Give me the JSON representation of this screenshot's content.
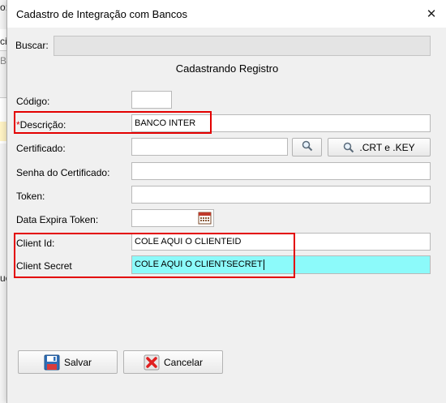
{
  "background": {
    "fragments": [
      "o:",
      "cia",
      "Ba",
      "ue"
    ]
  },
  "dialog": {
    "title": "Cadastro de Integração com Bancos",
    "close_symbol": "✕",
    "search": {
      "label": "Buscar:",
      "value": ""
    },
    "section_title": "Cadastrando Registro",
    "fields": {
      "codigo": {
        "label": "Código:",
        "value": ""
      },
      "descricao": {
        "required_mark": "*",
        "label": "Descrição:",
        "value": "BANCO INTER"
      },
      "certificado": {
        "label": "Certificado:",
        "value": ""
      },
      "senha_certificado": {
        "label": "Senha do Certificado:",
        "value": ""
      },
      "token": {
        "label": "Token:",
        "value": ""
      },
      "data_expira_token": {
        "label": "Data Expira Token:",
        "value": ""
      },
      "client_id": {
        "label": "Client Id:",
        "value": "COLE AQUI O CLIENTEID"
      },
      "client_secret": {
        "label": "Client Secret",
        "value": "COLE AQUI O CLIENTSECRET"
      }
    },
    "buttons": {
      "crt_key": ".CRT e .KEY",
      "salvar": "Salvar",
      "cancelar": "Cancelar"
    },
    "icons": {
      "search": "magnifier-icon",
      "calendar": "calendar-icon",
      "save": "floppy-disk-icon",
      "cancel": "red-x-icon"
    },
    "highlight_color": "#e30000",
    "active_field_color": "#8cfafa"
  }
}
